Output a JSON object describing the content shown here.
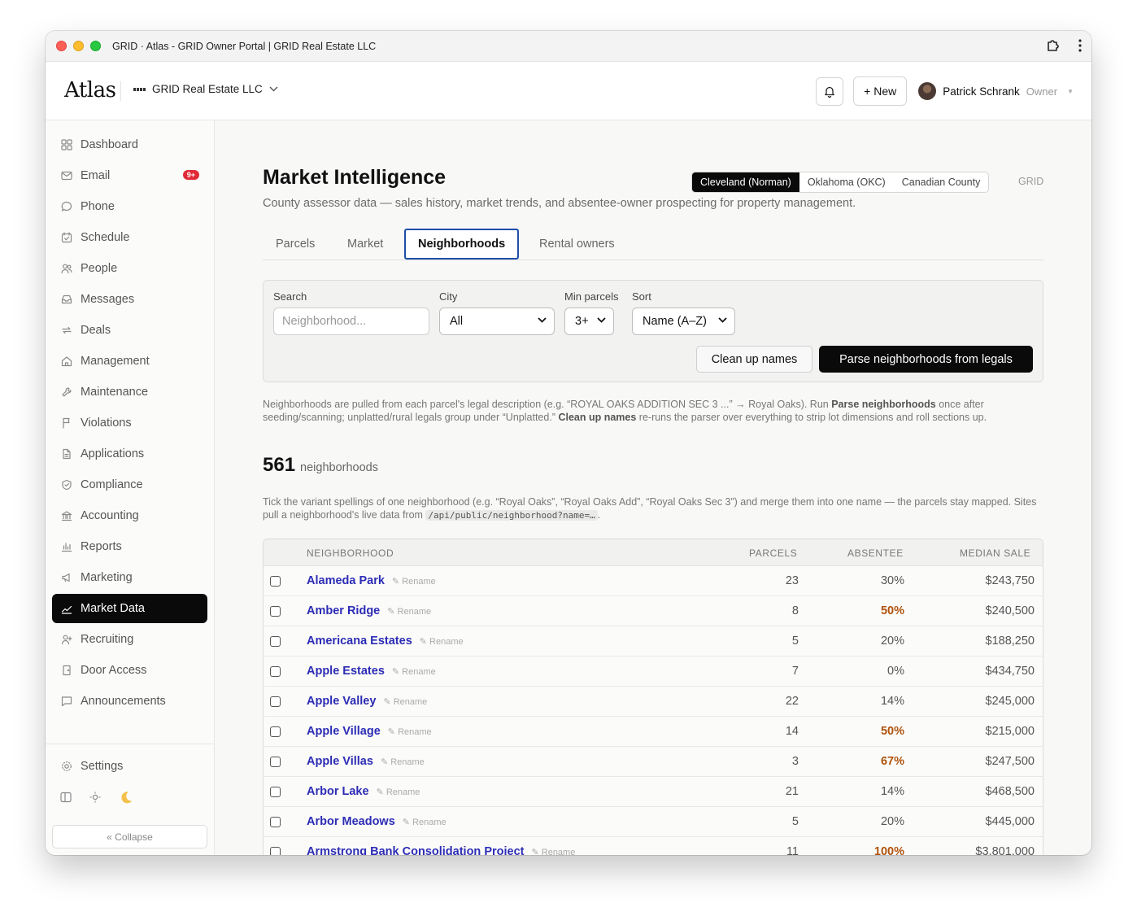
{
  "window": {
    "title": "GRID · Atlas - GRID Owner Portal | GRID Real Estate LLC"
  },
  "header": {
    "logo": "Atlas",
    "org_name": "GRID Real Estate LLC",
    "new_button": "+ New",
    "user_name": "Patrick Schrank",
    "user_role": "Owner"
  },
  "sidebar": {
    "items": [
      {
        "label": "Dashboard",
        "icon": "grid-icon"
      },
      {
        "label": "Email",
        "icon": "mail-icon",
        "badge": "9+"
      },
      {
        "label": "Phone",
        "icon": "chat-bubble-icon"
      },
      {
        "label": "Schedule",
        "icon": "calendar-check-icon"
      },
      {
        "label": "People",
        "icon": "people-icon"
      },
      {
        "label": "Messages",
        "icon": "inbox-icon"
      },
      {
        "label": "Deals",
        "icon": "repeat-icon"
      },
      {
        "label": "Management",
        "icon": "home-icon"
      },
      {
        "label": "Maintenance",
        "icon": "wrench-icon"
      },
      {
        "label": "Violations",
        "icon": "flag-icon"
      },
      {
        "label": "Applications",
        "icon": "document-icon"
      },
      {
        "label": "Compliance",
        "icon": "shield-icon"
      },
      {
        "label": "Accounting",
        "icon": "bank-icon"
      },
      {
        "label": "Reports",
        "icon": "bar-chart-icon"
      },
      {
        "label": "Marketing",
        "icon": "megaphone-icon"
      },
      {
        "label": "Market Data",
        "icon": "trend-line-icon",
        "active": true
      },
      {
        "label": "Recruiting",
        "icon": "user-plus-icon"
      },
      {
        "label": "Door Access",
        "icon": "door-icon"
      },
      {
        "label": "Announcements",
        "icon": "message-square-icon"
      }
    ],
    "settings": "Settings",
    "collapse": "« Collapse"
  },
  "page": {
    "title": "Market Intelligence",
    "subtitle": "County assessor data — sales history, market trends, and absentee-owner prospecting for property management.",
    "counties": [
      "Cleveland (Norman)",
      "Oklahoma (OKC)",
      "Canadian County"
    ],
    "active_county": "Cleveland (Norman)",
    "grid_tag": "GRID",
    "tabs": [
      "Parcels",
      "Market",
      "Neighborhoods",
      "Rental owners"
    ],
    "active_tab": "Neighborhoods"
  },
  "filters": {
    "search_label": "Search",
    "search_placeholder": "Neighborhood...",
    "city_label": "City",
    "city_value": "All",
    "min_parcels_label": "Min parcels",
    "min_parcels_value": "3+",
    "sort_label": "Sort",
    "sort_value": "Name (A–Z)",
    "clean_button": "Clean up names",
    "parse_button": "Parse neighborhoods from legals"
  },
  "help": {
    "p1_a": "Neighborhoods are pulled from each parcel's legal description (e.g. “ROYAL OAKS ADDITION SEC 3 ...” → Royal Oaks). Run ",
    "p1_b": "Parse neighborhoods",
    "p1_c": " once after seeding/scanning; unplatted/rural legals group under “Unplatted.” ",
    "p1_d": "Clean up names",
    "p1_e": " re-runs the parser over everything to strip lot dimensions and roll sections up."
  },
  "summary": {
    "count": "561",
    "label": "neighborhoods"
  },
  "merge_help": {
    "text": "Tick the variant spellings of one neighborhood (e.g. “Royal Oaks”, “Royal Oaks Add”, “Royal Oaks Sec 3”) and merge them into one name — the parcels stay mapped. Sites pull a neighborhood's live data from ",
    "code": "/api/public/neighborhood?name=…",
    "tail": "."
  },
  "table": {
    "columns": [
      "NEIGHBORHOOD",
      "PARCELS",
      "ABSENTEE",
      "MEDIAN SALE"
    ],
    "rename_label": "✎ Rename",
    "rows": [
      {
        "name": "Alameda Park",
        "parcels": "23",
        "absentee": "30%",
        "median": "$243,750",
        "hi": false
      },
      {
        "name": "Amber Ridge",
        "parcels": "8",
        "absentee": "50%",
        "median": "$240,500",
        "hi": true
      },
      {
        "name": "Americana Estates",
        "parcels": "5",
        "absentee": "20%",
        "median": "$188,250",
        "hi": false
      },
      {
        "name": "Apple Estates",
        "parcels": "7",
        "absentee": "0%",
        "median": "$434,750",
        "hi": false
      },
      {
        "name": "Apple Valley",
        "parcels": "22",
        "absentee": "14%",
        "median": "$245,000",
        "hi": false
      },
      {
        "name": "Apple Village",
        "parcels": "14",
        "absentee": "50%",
        "median": "$215,000",
        "hi": true
      },
      {
        "name": "Apple Villas",
        "parcels": "3",
        "absentee": "67%",
        "median": "$247,500",
        "hi": true
      },
      {
        "name": "Arbor Lake",
        "parcels": "21",
        "absentee": "14%",
        "median": "$468,500",
        "hi": false
      },
      {
        "name": "Arbor Meadows",
        "parcels": "5",
        "absentee": "20%",
        "median": "$445,000",
        "hi": false
      },
      {
        "name": "Armstrong Bank Consolidation Project",
        "parcels": "11",
        "absentee": "100%",
        "median": "$3,801,000",
        "hi": true
      }
    ]
  },
  "colors": {
    "accent": "#0a0a0a",
    "link": "#2c2cb5",
    "highlight": "#b0530c",
    "badge": "#e02a36",
    "tab_focus": "#1d4ea8"
  }
}
